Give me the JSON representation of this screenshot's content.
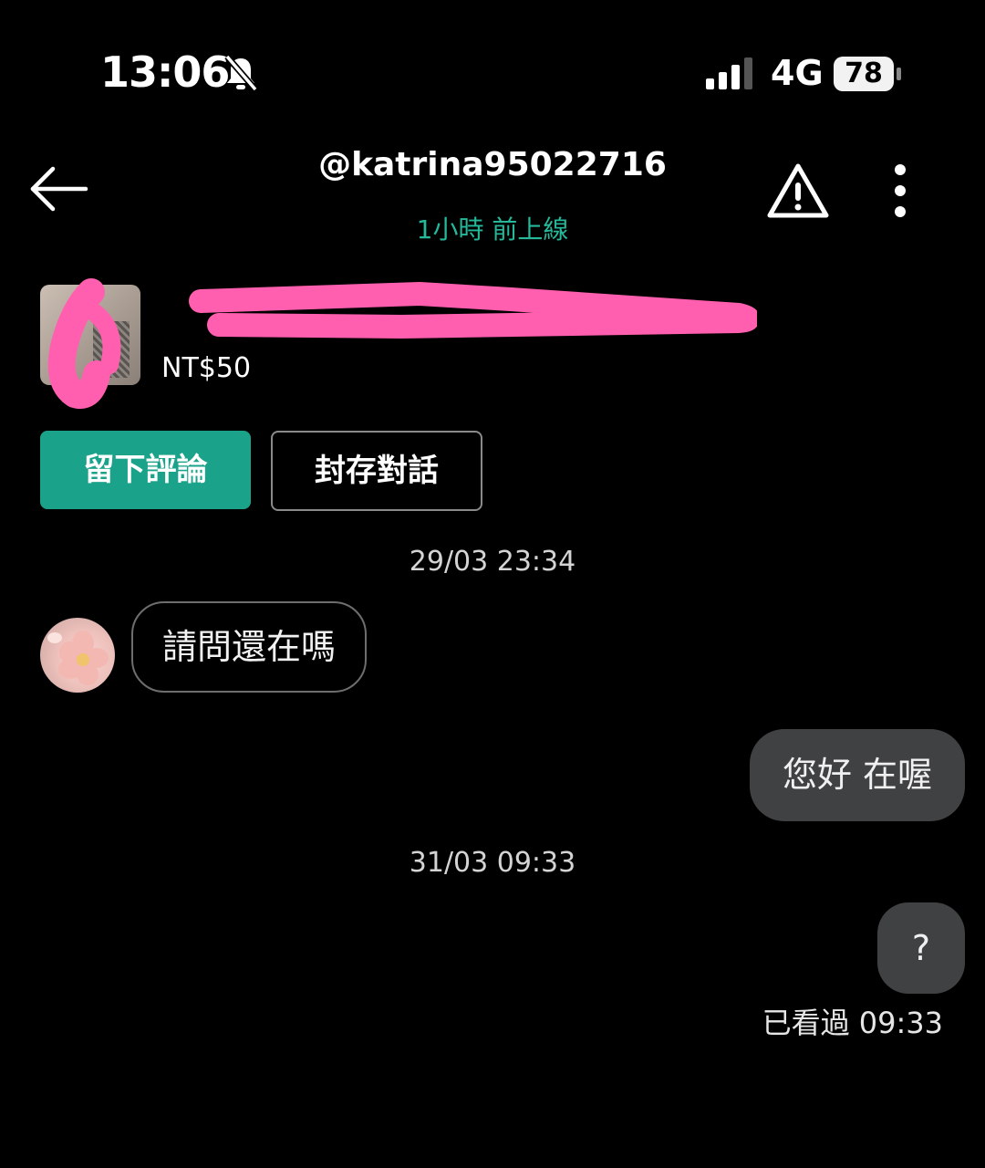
{
  "status_bar": {
    "time": "13:06",
    "network": "4G",
    "battery": "78",
    "icons": [
      "bell-off-icon",
      "signal-icon"
    ]
  },
  "header": {
    "back_icon": "arrow-left-icon",
    "username": "@katrina95022716",
    "online_status": "1小時 前上線",
    "report_icon": "warning-triangle-icon",
    "more_icon": "more-vertical-icon",
    "accent_color": "#25b89a"
  },
  "listing": {
    "price": "NT$50",
    "title_redacted": true
  },
  "actions": {
    "leave_review": "留下評論",
    "archive": "封存對話",
    "primary_color": "#1aa38a"
  },
  "chat": {
    "messages": [
      {
        "timestamp": "29/03 23:34"
      },
      {
        "from": "other",
        "text": "請問還在嗎"
      },
      {
        "from": "me",
        "text": "您好 在喔"
      },
      {
        "timestamp": "31/03 09:33"
      },
      {
        "from": "me",
        "text": "?"
      }
    ],
    "read_receipt": "已看過 09:33"
  }
}
